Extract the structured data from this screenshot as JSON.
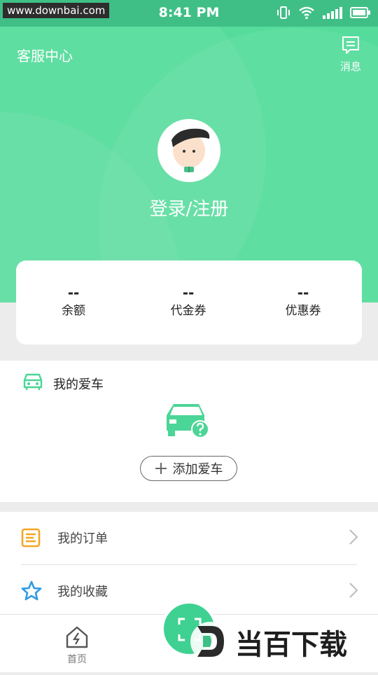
{
  "status_bar": {
    "watermark": "www.downbai.com",
    "time": "8:41 PM"
  },
  "header": {
    "customer_service": "客服中心",
    "messages_label": "消息"
  },
  "profile": {
    "login_text": "登录/注册"
  },
  "wallet": {
    "items": [
      {
        "value": "--",
        "label": "余额"
      },
      {
        "value": "--",
        "label": "代金券"
      },
      {
        "value": "--",
        "label": "优惠券"
      }
    ]
  },
  "cars": {
    "title": "我的爱车",
    "add_button": "添加爱车"
  },
  "menu": {
    "items": [
      {
        "label": "我的订单"
      },
      {
        "label": "我的收藏"
      }
    ]
  },
  "tabbar": {
    "home_label": "首页"
  },
  "brand_watermark": {
    "text": "当百下载"
  },
  "colors": {
    "primary": "#55dc9c",
    "accent_orange": "#f4a623",
    "accent_blue": "#2f9be6"
  }
}
